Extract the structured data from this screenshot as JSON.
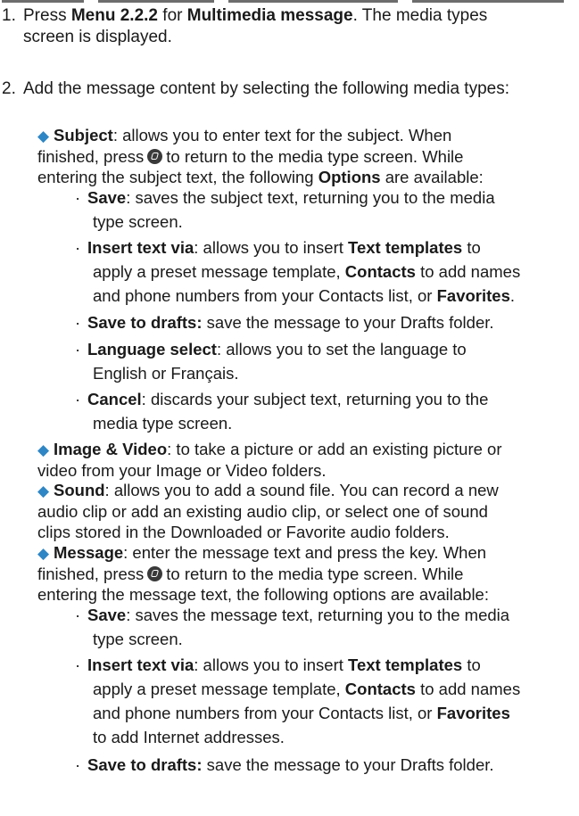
{
  "steps": [
    {
      "num": "1.",
      "pre": "Press ",
      "b1": "Menu 2.2.2",
      "mid": " for ",
      "b2": "Multimedia message",
      "post": ". The media types",
      "line2": "screen is displayed."
    },
    {
      "num": "2.",
      "text": "Add the message content by selecting the following media types:"
    }
  ],
  "subject": {
    "label": "Subject",
    "l1": ": allows you to enter text for the subject. When",
    "l2a": "finished, press",
    "l2b": "to return to the media type screen. While",
    "l3a": "entering the subject text, the following ",
    "l3b": "Options",
    "l3c": " are available:"
  },
  "subject_options": [
    {
      "label": "Save",
      "a": ": saves the subject text, returning you to the media",
      "b": "type screen."
    },
    {
      "label": "Insert text via",
      "a": ": allows you to insert ",
      "t1": "Text templates",
      "a2": " to",
      "b": "apply a preset message template, ",
      "t2": "Contacts",
      "b2": " to add names",
      "c": "and phone numbers from your Contacts list, or ",
      "t3": "Favorites",
      "c2": "."
    },
    {
      "label": "Save to drafts:",
      "a": " save the message to your Drafts folder."
    },
    {
      "label": "Language select",
      "a": ": allows you to set the language to",
      "b": "English or Français."
    },
    {
      "label": "Cancel",
      "a": ": discards your subject text, returning you to the",
      "b": "media type screen."
    }
  ],
  "image_video": {
    "label": "Image & Video",
    "l1": ": to take a picture or add an existing picture or",
    "l2": "video from your Image or Video folders."
  },
  "sound": {
    "label": "Sound",
    "l1": ": allows you to add a sound file. You can record a new",
    "l2": "audio clip or add an existing audio clip, or select one of sound",
    "l3": "clips stored in the Downloaded or Favorite audio folders."
  },
  "message": {
    "label": "Message",
    "l1": ": enter the message text and press the key. When",
    "l2a": "finished, press",
    "l2b": "to return to the media type screen. While",
    "l3": "entering the message text, the following options are available:"
  },
  "message_options": [
    {
      "label": "Save",
      "a": ": saves the message text, returning you to the media",
      "b": "type screen."
    },
    {
      "label": "Insert text via",
      "a": ": allows you to insert ",
      "t1": "Text templates",
      "a2": " to",
      "b": "apply a preset message template, ",
      "t2": "Contacts",
      "b2": " to add names",
      "c": "and phone numbers from your Contacts list, or ",
      "t3": "Favorites",
      "d": "to add Internet addresses."
    },
    {
      "label": "Save to drafts:",
      "a": " save the message to your Drafts folder."
    }
  ]
}
